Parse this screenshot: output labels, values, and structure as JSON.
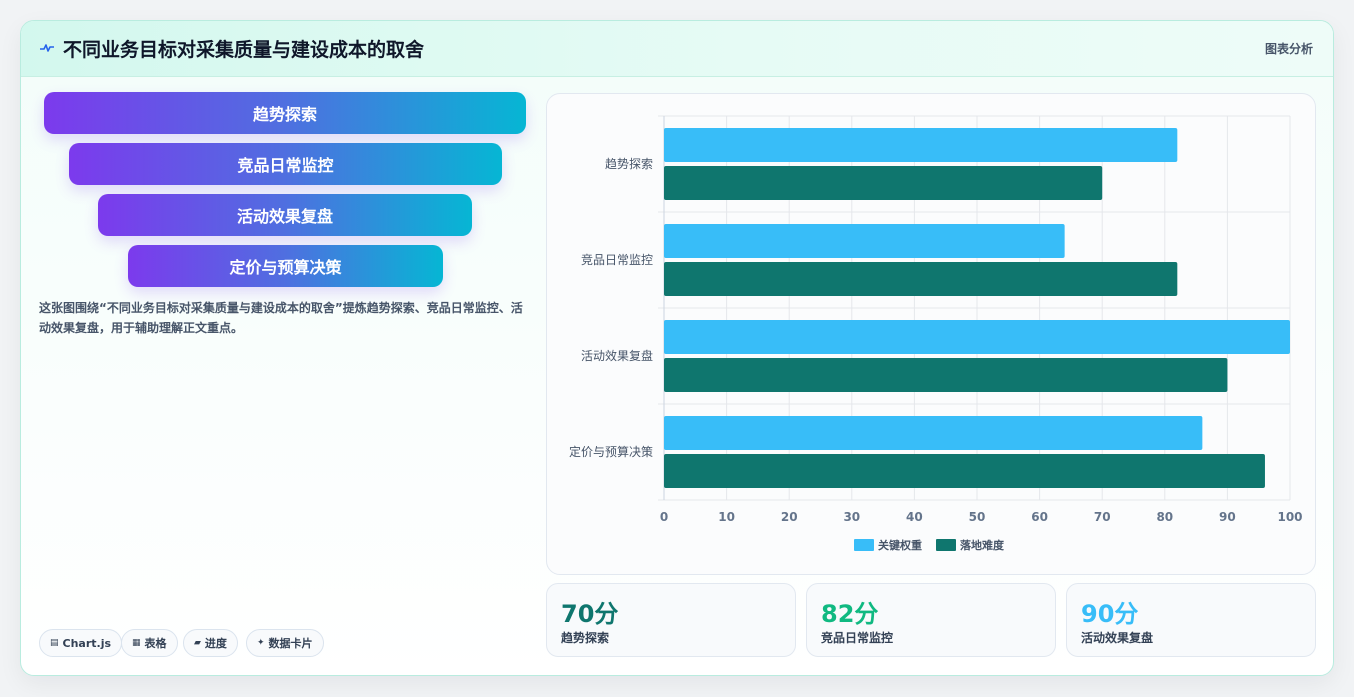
{
  "header": {
    "icon": "pulse-icon",
    "title": "不同业务目标对采集质量与建设成本的取舍",
    "right_label": "图表分析"
  },
  "funnel": [
    {
      "label": "趋势探索"
    },
    {
      "label": "竞品日常监控"
    },
    {
      "label": "活动效果复盘"
    },
    {
      "label": "定价与预算决策"
    }
  ],
  "description": "这张图围绕“不同业务目标对采集质量与建设成本的取舍”提炼趋势探索、竞品日常监控、活动效果复盘，用于辅助理解正文重点。",
  "tags": [
    {
      "icon": "chart-icon",
      "glyph": "▤",
      "label": "Chart.js"
    },
    {
      "icon": "table-icon",
      "glyph": "▦",
      "label": "表格"
    },
    {
      "icon": "progress-icon",
      "glyph": "▰",
      "label": "进度"
    },
    {
      "icon": "sparkle-icon",
      "glyph": "✦",
      "label": "数据卡片"
    }
  ],
  "stats": [
    {
      "value": "70分",
      "label": "趋势探索",
      "color": "#0f766e"
    },
    {
      "value": "82分",
      "label": "竞品日常监控",
      "color": "#10b981"
    },
    {
      "value": "90分",
      "label": "活动效果复盘",
      "color": "#38bdf8"
    }
  ],
  "colors": {
    "series_1": "#38bdf8",
    "series_2": "#0f766e"
  },
  "chart_data": {
    "type": "bar",
    "orientation": "horizontal",
    "categories": [
      "趋势探索",
      "竞品日常监控",
      "活动效果复盘",
      "定价与预算决策"
    ],
    "series": [
      {
        "name": "关键权重",
        "values": [
          82,
          64,
          100,
          86
        ],
        "color": "#38bdf8"
      },
      {
        "name": "落地难度",
        "values": [
          70,
          82,
          90,
          96
        ],
        "color": "#0f766e"
      }
    ],
    "xlim": [
      0,
      100
    ],
    "xticks": [
      0,
      10,
      20,
      30,
      40,
      50,
      60,
      70,
      80,
      90,
      100
    ],
    "grid": true,
    "legend": "bottom"
  }
}
